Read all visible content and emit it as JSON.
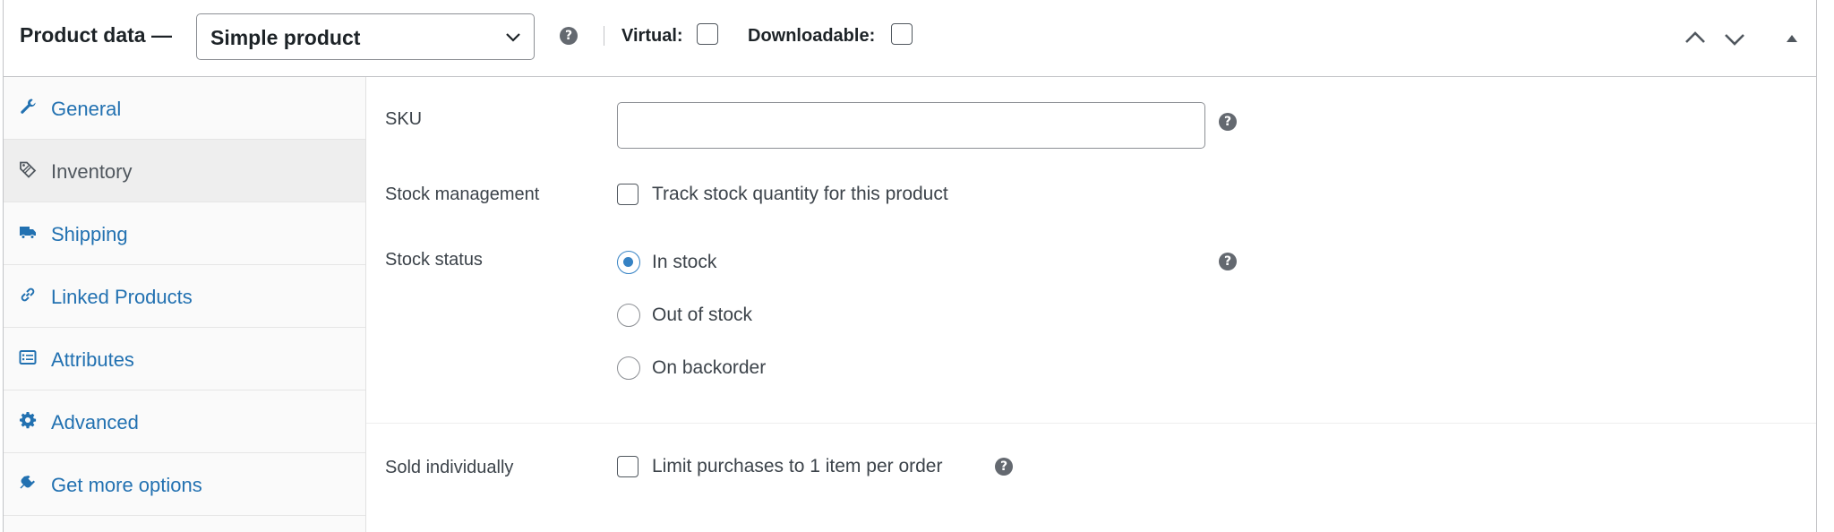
{
  "header": {
    "title": "Product data —",
    "product_type": {
      "selected": "Simple product"
    },
    "virtual_label": "Virtual:",
    "downloadable_label": "Downloadable:",
    "virtual_checked": false,
    "downloadable_checked": false
  },
  "tabs": [
    {
      "label": "General",
      "icon": "wrench-icon",
      "active": false
    },
    {
      "label": "Inventory",
      "icon": "tag-icon",
      "active": true
    },
    {
      "label": "Shipping",
      "icon": "truck-icon",
      "active": false
    },
    {
      "label": "Linked Products",
      "icon": "link-icon",
      "active": false
    },
    {
      "label": "Attributes",
      "icon": "list-icon",
      "active": false
    },
    {
      "label": "Advanced",
      "icon": "gear-icon",
      "active": false
    },
    {
      "label": "Get more options",
      "icon": "plug-icon",
      "active": false
    }
  ],
  "inventory": {
    "sku": {
      "label": "SKU",
      "value": ""
    },
    "stock_management": {
      "label": "Stock management",
      "checkbox_label": "Track stock quantity for this product",
      "checked": false
    },
    "stock_status": {
      "label": "Stock status",
      "options": [
        "In stock",
        "Out of stock",
        "On backorder"
      ],
      "selected": "In stock"
    },
    "sold_individually": {
      "label": "Sold individually",
      "checkbox_label": "Limit purchases to 1 item per order",
      "checked": false
    }
  },
  "colors": {
    "link": "#2271b1",
    "accent": "#3582c4",
    "border": "#c3c4c7"
  }
}
